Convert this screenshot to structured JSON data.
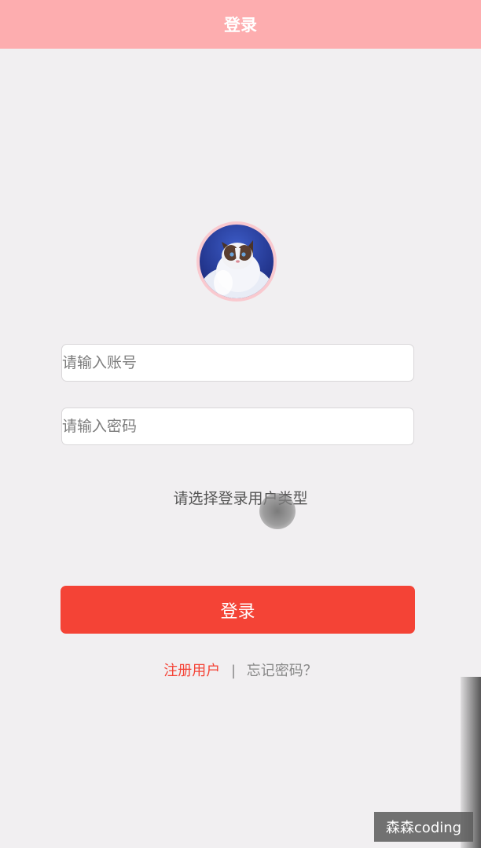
{
  "navbar": {
    "title": "登录"
  },
  "form": {
    "account_placeholder": "请输入账号",
    "password_placeholder": "请输入密码",
    "user_type_prompt": "请选择登录用户类型",
    "login_button_label": "登录"
  },
  "links": {
    "register": "注册用户",
    "separator": "|",
    "forgot_password": "忘记密码？"
  },
  "watermark": "森森coding",
  "colors": {
    "navbar_bg": "#fdadaf",
    "page_bg": "#f1eff1",
    "primary_button": "#f44336",
    "register_link": "#f44336",
    "avatar_ring": "#f9c9cf"
  },
  "icons": {
    "avatar": "cat-avatar-image"
  }
}
